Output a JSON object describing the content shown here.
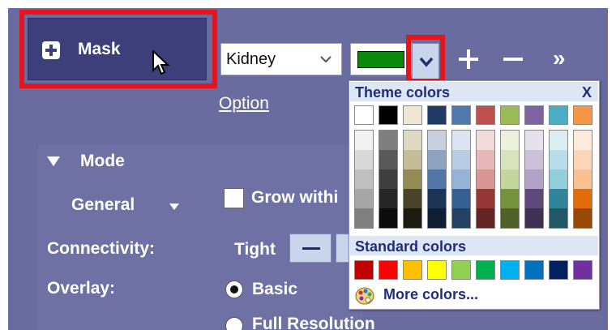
{
  "mask_button": {
    "label": "Mask"
  },
  "target_dropdown": {
    "value": "Kidney"
  },
  "color_picker": {
    "current_color": "#0a8a0a"
  },
  "toolbar": {
    "plus": "+",
    "minus": "−",
    "more": "»"
  },
  "option_link": "Option",
  "mode_section": {
    "title": "Mode",
    "general_label": "General",
    "grow_within_label": "Grow withi",
    "connectivity_label": "Connectivity:",
    "connectivity_value": "Tight",
    "overlay_label": "Overlay:",
    "overlay_options": [
      "Basic",
      "Full Resolution"
    ],
    "overlay_selected": "Basic"
  },
  "color_popup": {
    "theme_title": "Theme colors",
    "close_label": "X",
    "theme_colors": [
      "#ffffff",
      "#000000",
      "#efe6d4",
      "#1f3a66",
      "#4f78ad",
      "#c0504d",
      "#9bbb59",
      "#8064a2",
      "#4bacc6",
      "#f79646"
    ],
    "shade_columns": [
      [
        "#f2f2f2",
        "#d9d9d9",
        "#bfbfbf",
        "#a6a6a6",
        "#808080"
      ],
      [
        "#7f7f7f",
        "#595959",
        "#3f3f3f",
        "#262626",
        "#0c0c0c"
      ],
      [
        "#ddd9c3",
        "#c4bd97",
        "#948a54",
        "#4a452a",
        "#1d1b10"
      ],
      [
        "#c6d0de",
        "#8ea3c2",
        "#5277a6",
        "#1c3557",
        "#0f1e33"
      ],
      [
        "#dbe5f1",
        "#b8cce4",
        "#95b3d7",
        "#366092",
        "#244062"
      ],
      [
        "#f2dcdb",
        "#e6b9b8",
        "#d99694",
        "#953734",
        "#632423"
      ],
      [
        "#ebf1dd",
        "#d7e3bc",
        "#c3d69b",
        "#76923c",
        "#4f6128"
      ],
      [
        "#e5e0ec",
        "#ccc1d9",
        "#b2a2c7",
        "#5f497a",
        "#3f3151"
      ],
      [
        "#dbeef3",
        "#b7dde8",
        "#92cddc",
        "#31859b",
        "#205867"
      ],
      [
        "#fdeada",
        "#fbd5b5",
        "#fac08f",
        "#e36c09",
        "#974806"
      ]
    ],
    "standard_title": "Standard colors",
    "standard_colors": [
      "#c00000",
      "#ff0000",
      "#ffc000",
      "#ffff00",
      "#92d050",
      "#00b050",
      "#00b0f0",
      "#0070c0",
      "#002060",
      "#7030a0"
    ],
    "more_colors_label": "More colors..."
  }
}
